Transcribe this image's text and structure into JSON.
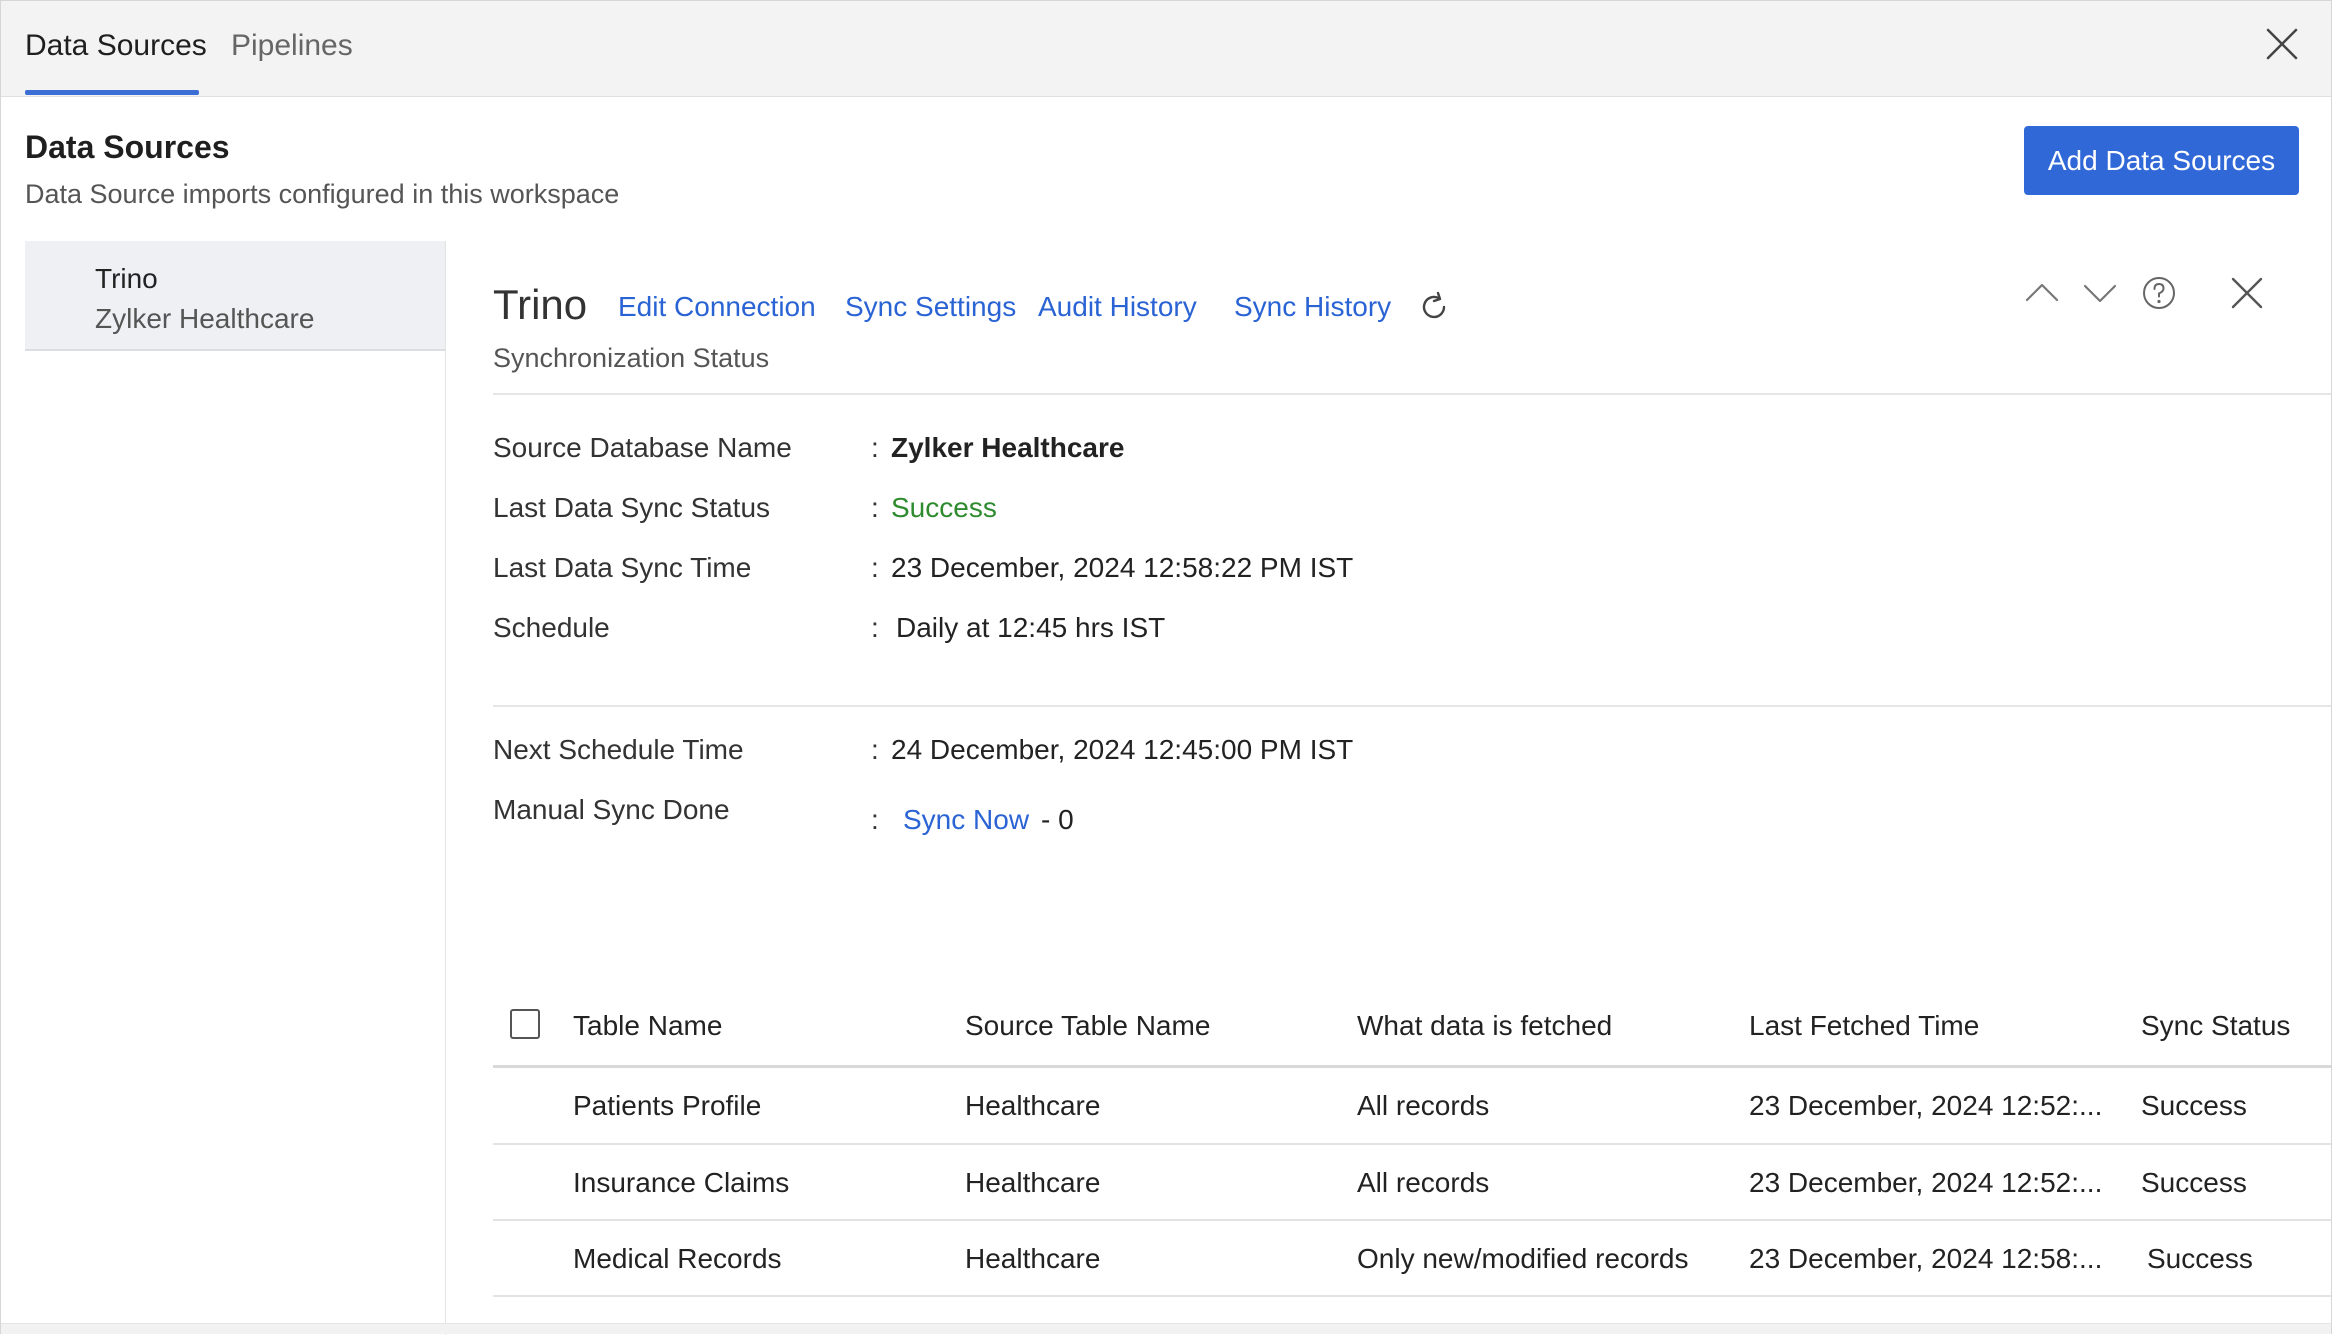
{
  "tabs": [
    {
      "label": "Data Sources",
      "active": true
    },
    {
      "label": "Pipelines",
      "active": false
    }
  ],
  "header": {
    "title": "Data Sources",
    "subtitle": "Data Source imports configured in this workspace",
    "add_button": "Add Data Sources"
  },
  "sidebar": {
    "items": [
      {
        "name": "Trino",
        "workspace": "Zylker Healthcare"
      }
    ]
  },
  "detail": {
    "title": "Trino",
    "links": [
      "Edit Connection",
      "Sync Settings",
      "Audit History",
      "Sync History"
    ],
    "section_label": "Synchronization Status",
    "info": [
      {
        "label": "Source Database Name",
        "value": "Zylker Healthcare"
      },
      {
        "label": "Last Data Sync Status",
        "value": "Success"
      },
      {
        "label": "Last Data Sync Time",
        "value": "23 December, 2024 12:58:22 PM IST"
      },
      {
        "label": "Schedule",
        "value": "Daily at 12:45 hrs IST"
      }
    ],
    "next_schedule": {
      "label": "Next Schedule Time",
      "value": "24 December, 2024 12:45:00 PM IST"
    },
    "manual_sync": {
      "label": "Manual Sync Done",
      "link": "Sync Now",
      "count": "- 0"
    }
  },
  "table": {
    "columns": [
      "Table Name",
      "Source Table Name",
      "What data is fetched",
      "Last Fetched Time",
      "Sync Status"
    ],
    "rows": [
      [
        "Patients Profile",
        "Healthcare",
        "All records",
        "23 December, 2024 12:52:...",
        "Success"
      ],
      [
        "Insurance Claims",
        "Healthcare",
        "All records",
        "23 December, 2024 12:52:...",
        "Success"
      ],
      [
        "Medical Records",
        "Healthcare",
        "Only new/modified records",
        "23 December, 2024 12:58:...",
        "Success"
      ]
    ]
  },
  "colors": {
    "accent": "#3168d8",
    "link": "#2a63d4",
    "success": "#2e8b2e"
  },
  "icons": [
    "close-icon",
    "refresh-icon",
    "chevron-up-icon",
    "chevron-down-icon",
    "help-icon",
    "close-icon"
  ]
}
